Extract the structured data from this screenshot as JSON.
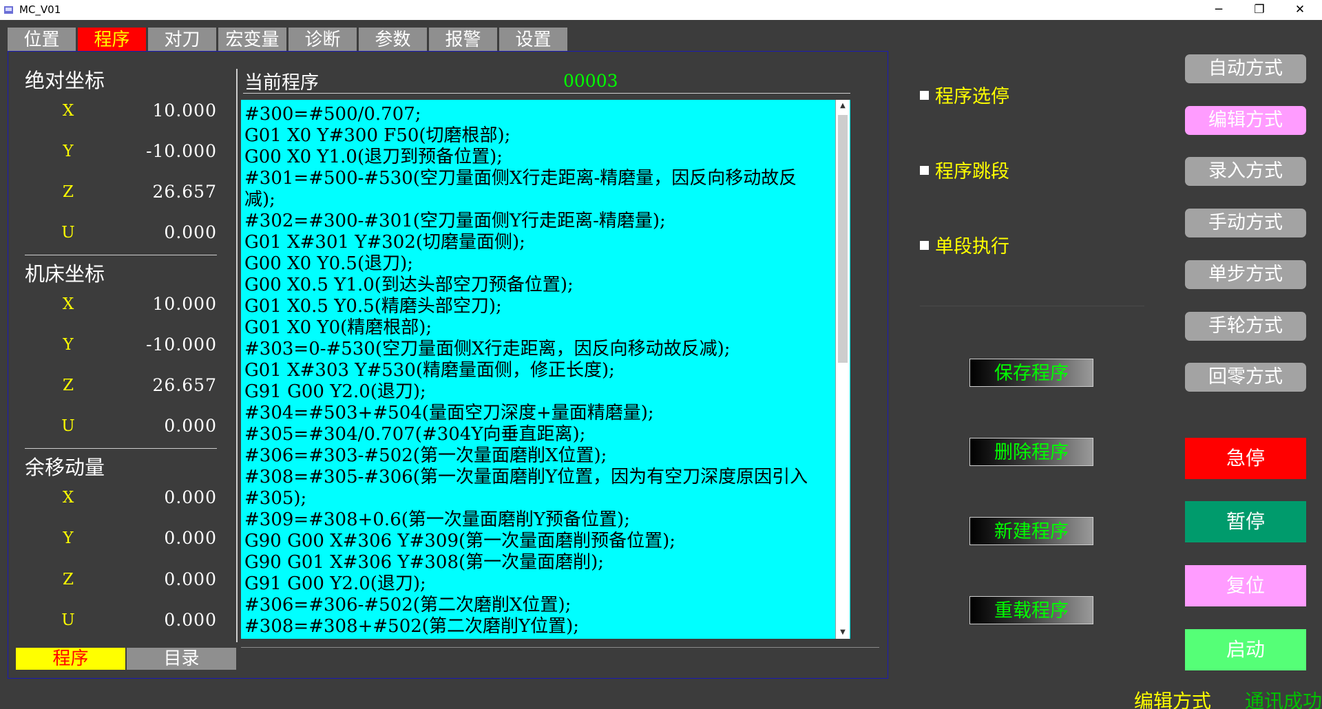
{
  "window": {
    "title": "MC_V01",
    "minimize": "─",
    "restore": "❐",
    "close": "✕"
  },
  "tabs": [
    "位置",
    "程序",
    "对刀",
    "宏变量",
    "诊断",
    "参数",
    "报警",
    "设置"
  ],
  "active_tab": "程序",
  "coords": {
    "absolute": {
      "title": "绝对坐标",
      "rows": [
        {
          "axis": "X",
          "value": "10.000"
        },
        {
          "axis": "Y",
          "value": "-10.000"
        },
        {
          "axis": "Z",
          "value": "26.657"
        },
        {
          "axis": "U",
          "value": "0.000"
        }
      ]
    },
    "machine": {
      "title": "机床坐标",
      "rows": [
        {
          "axis": "X",
          "value": "10.000"
        },
        {
          "axis": "Y",
          "value": "-10.000"
        },
        {
          "axis": "Z",
          "value": "26.657"
        },
        {
          "axis": "U",
          "value": "0.000"
        }
      ]
    },
    "remaining": {
      "title": "余移动量",
      "rows": [
        {
          "axis": "X",
          "value": "0.000"
        },
        {
          "axis": "Y",
          "value": "0.000"
        },
        {
          "axis": "Z",
          "value": "0.000"
        },
        {
          "axis": "U",
          "value": "0.000"
        }
      ]
    }
  },
  "program": {
    "label": "当前程序",
    "number": "00003",
    "lines": [
      "#300=#500/0.707;",
      "G01 X0 Y#300 F50(切磨根部);",
      "G00 X0 Y1.0(退刀到预备位置);",
      "#301=#500-#530(空刀量面侧X行走距离-精磨量，因反向移动故反",
      "减);",
      "#302=#300-#301(空刀量面侧Y行走距离-精磨量);",
      "G01 X#301 Y#302(切磨量面侧);",
      "G00 X0 Y0.5(退刀);",
      "G00 X0.5 Y1.0(到达头部空刀预备位置);",
      "G01 X0.5 Y0.5(精磨头部空刀);",
      "G01 X0 Y0(精磨根部);",
      "#303=0-#530(空刀量面侧X行走距离，因反向移动故反减);",
      "G01 X#303 Y#530(精磨量面侧，修正长度);",
      "G91 G00 Y2.0(退刀);",
      "#304=#503+#504(量面空刀深度+量面精磨量);",
      "#305=#304/0.707(#304Y向垂直距离);",
      "#306=#303-#502(第一次量面磨削X位置);",
      "#308=#305-#306(第一次量面磨削Y位置，因为有空刀深度原因引入",
      "#305);",
      "#309=#308+0.6(第一次量面磨削Y预备位置);",
      "G90 G00 X#306 Y#309(第一次量面磨削预备位置);",
      "G90 G01 X#306 Y#308(第一次量面磨削);",
      "G91 G00 Y2.0(退刀);",
      "#306=#306-#502(第二次磨削X位置);",
      "#308=#308+#502(第二次磨削Y位置);"
    ]
  },
  "bottom_tabs": [
    "程序",
    "目录"
  ],
  "options": [
    "程序选停",
    "程序跳段",
    "单段执行"
  ],
  "program_buttons": [
    "保存程序",
    "删除程序",
    "新建程序",
    "重载程序"
  ],
  "modes": [
    "自动方式",
    "编辑方式",
    "录入方式",
    "手动方式",
    "单步方式",
    "手轮方式",
    "回零方式"
  ],
  "active_mode": "编辑方式",
  "controls": [
    {
      "label": "急停",
      "color": "#ff0000"
    },
    {
      "label": "暂停",
      "color": "#009b6c"
    },
    {
      "label": "复位",
      "color": "#ff9cff"
    },
    {
      "label": "启动",
      "color": "#55ff77"
    }
  ],
  "status": {
    "mode": "编辑方式",
    "comm": "通讯成功"
  }
}
